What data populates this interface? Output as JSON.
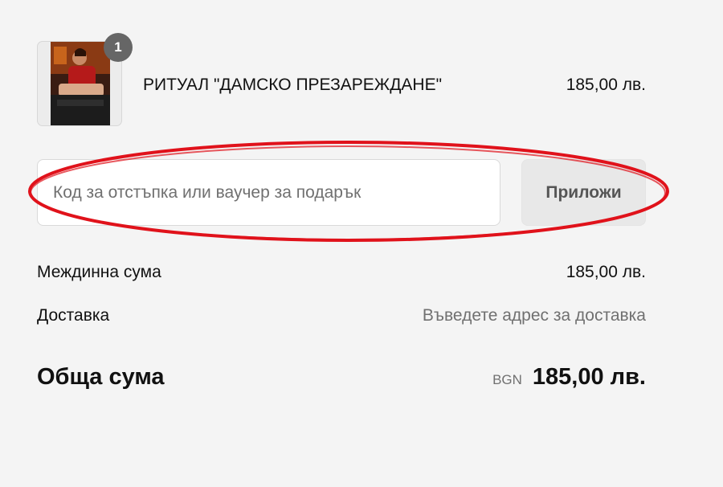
{
  "cart": {
    "item": {
      "title": "РИТУАЛ \"ДАМСКО ПРЕЗАРЕЖДАНЕ\"",
      "price": "185,00 лв.",
      "quantity": "1",
      "image_icon": "product-photo-icon"
    }
  },
  "discount": {
    "placeholder": "Код за отстъпка или ваучер за подарък",
    "apply_label": "Приложи"
  },
  "summary": {
    "subtotal_label": "Междинна сума",
    "subtotal_value": "185,00 лв.",
    "shipping_label": "Доставка",
    "shipping_value": "Въведете адрес за доставка",
    "total_label": "Обща сума",
    "total_currency": "BGN",
    "total_value": "185,00 лв."
  },
  "colors": {
    "background": "#f4f4f4",
    "annotation_red": "#e0121b",
    "badge": "#666666"
  }
}
